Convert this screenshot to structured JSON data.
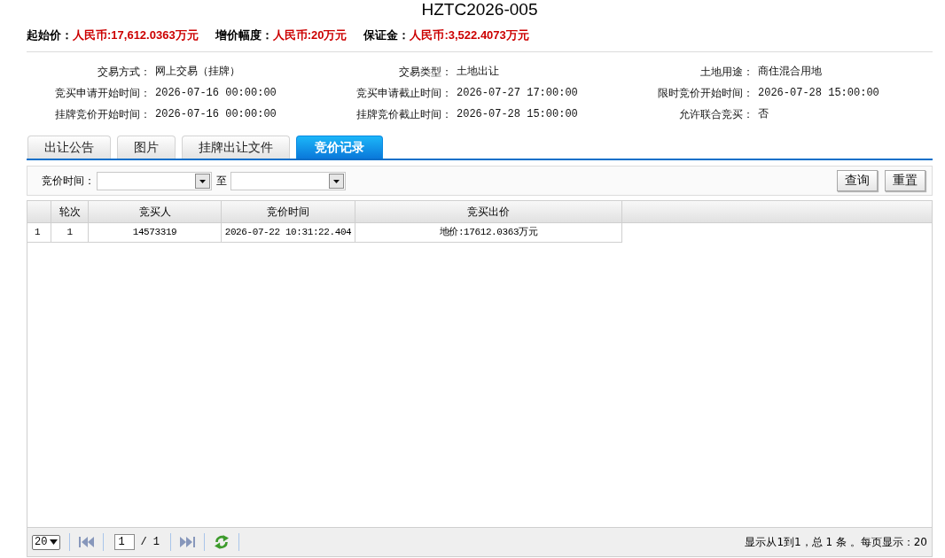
{
  "title": "HZTC2026-005",
  "summary": [
    {
      "label": "起始价：",
      "value": "人民币:17,612.0363万元"
    },
    {
      "label": "增价幅度：",
      "value": "人民币:20万元"
    },
    {
      "label": "保证金：",
      "value": "人民币:3,522.4073万元"
    }
  ],
  "info": [
    {
      "label": "交易方式：",
      "value": "网上交易（挂牌）"
    },
    {
      "label": "交易类型：",
      "value": "土地出让"
    },
    {
      "label": "土地用途：",
      "value": "商住混合用地"
    },
    {
      "label": "竞买申请开始时间：",
      "value": "2026-07-16 00:00:00"
    },
    {
      "label": "竞买申请截止时间：",
      "value": "2026-07-27 17:00:00"
    },
    {
      "label": "限时竞价开始时间：",
      "value": "2026-07-28 15:00:00"
    },
    {
      "label": "挂牌竞价开始时间：",
      "value": "2026-07-16 00:00:00"
    },
    {
      "label": "挂牌竞价截止时间：",
      "value": "2026-07-28 15:00:00"
    },
    {
      "label": "允许联合竞买：",
      "value": "否"
    }
  ],
  "tabs": [
    {
      "label": "出让公告",
      "selected": false
    },
    {
      "label": "图片",
      "selected": false
    },
    {
      "label": "挂牌出让文件",
      "selected": false
    },
    {
      "label": "竞价记录",
      "selected": true
    }
  ],
  "filter": {
    "label": "竞价时间：",
    "separator": "至",
    "buttons": [
      "查询",
      "重置"
    ]
  },
  "table": {
    "columns": [
      "轮次",
      "竞买人",
      "竞价时间",
      "竞买出价"
    ],
    "rows": [
      {
        "row_number": "1",
        "cells": [
          "1",
          "14573319",
          "2026-07-22 10:31:22.404",
          "地价:17612.0363万元"
        ]
      }
    ]
  },
  "pager": {
    "page_size": "20",
    "page": "1",
    "page_count": "/ 1",
    "summary": "显示从1到1，总 1 条 。每页显示：20"
  }
}
